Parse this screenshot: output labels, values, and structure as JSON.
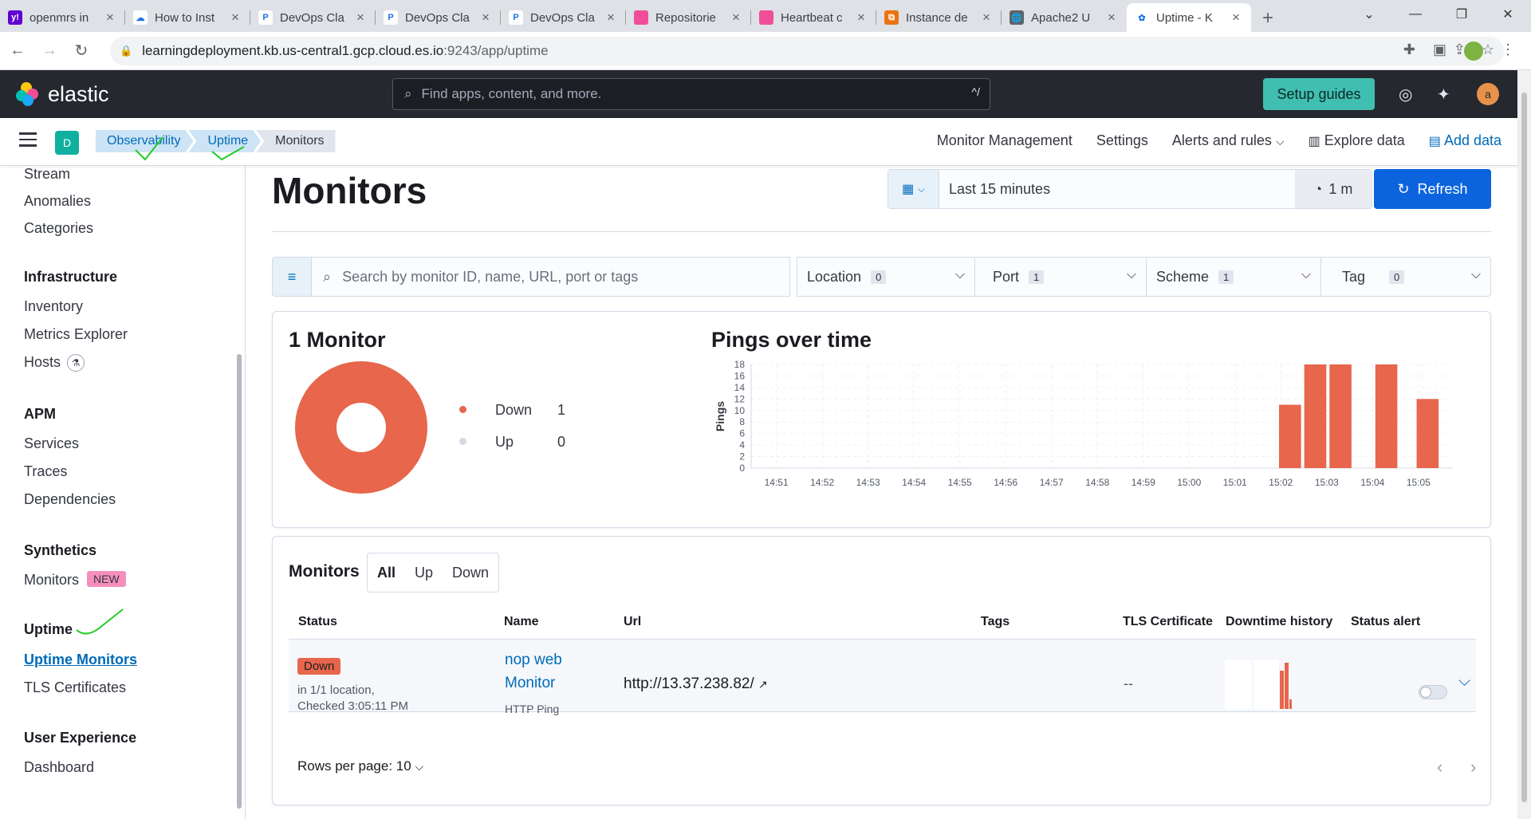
{
  "browser": {
    "tabs": [
      {
        "title": "openmrs in",
        "fav_color": "#6001d2",
        "fav_glyph": "y!"
      },
      {
        "title": "How to Inst",
        "fav_color": "#ffffff",
        "fav_glyph": "☁"
      },
      {
        "title": "DevOps Cla",
        "fav_color": "#ffffff",
        "fav_glyph": "P"
      },
      {
        "title": "DevOps Cla",
        "fav_color": "#ffffff",
        "fav_glyph": "P"
      },
      {
        "title": "DevOps Cla",
        "fav_color": "#ffffff",
        "fav_glyph": "P"
      },
      {
        "title": "Repositorie",
        "fav_color": "#f04e98",
        "fav_glyph": ""
      },
      {
        "title": "Heartbeat c",
        "fav_color": "#f04e98",
        "fav_glyph": ""
      },
      {
        "title": "Instance de",
        "fav_color": "#ec7211",
        "fav_glyph": "⧉"
      },
      {
        "title": "Apache2 U",
        "fav_color": "#5f6368",
        "fav_glyph": "🌐"
      },
      {
        "title": "Uptime - K",
        "fav_color": "#ffffff",
        "fav_glyph": "✿"
      }
    ],
    "url_host": "learningdeployment.kb.us-central1.gcp.cloud.es.io",
    "url_rest": ":9243/app/uptime"
  },
  "header": {
    "brand": "elastic",
    "search_placeholder": "Find apps, content, and more.",
    "search_shortcut": "^/",
    "setup_label": "Setup guides",
    "avatar_letter": "a"
  },
  "subheader": {
    "space_letter": "D",
    "breadcrumbs": [
      "Observability",
      "Uptime",
      "Monitors"
    ],
    "nav": {
      "monitor_management": "Monitor Management",
      "settings": "Settings",
      "alerts": "Alerts and rules",
      "explore": "Explore data",
      "add_data": "Add data"
    }
  },
  "sidebar": {
    "logs_items": [
      "Stream",
      "Anomalies",
      "Categories"
    ],
    "infra_title": "Infrastructure",
    "infra_items": [
      "Inventory",
      "Metrics Explorer",
      "Hosts"
    ],
    "apm_title": "APM",
    "apm_items": [
      "Services",
      "Traces",
      "Dependencies"
    ],
    "synthetics_title": "Synthetics",
    "synthetics_monitors": "Monitors",
    "new_badge": "NEW",
    "uptime_title": "Uptime",
    "uptime_monitors": "Uptime Monitors",
    "tls": "TLS Certificates",
    "ux_title": "User Experience",
    "dashboard": "Dashboard"
  },
  "page": {
    "title": "Monitors",
    "date_range": "Last 15 minutes",
    "refresh_interval": "1 m",
    "refresh_label": "Refresh",
    "search_placeholder": "Search by monitor ID, name, URL, port or tags",
    "filters": [
      {
        "label": "Location",
        "count": "0"
      },
      {
        "label": "Port",
        "count": "1"
      },
      {
        "label": "Scheme",
        "count": "1"
      },
      {
        "label": "Tag",
        "count": "0"
      }
    ]
  },
  "summary": {
    "title": "1 Monitor",
    "down_label": "Down",
    "down_count": "1",
    "up_label": "Up",
    "up_count": "0",
    "down_color": "#e7664c",
    "up_color": "#d3dae6"
  },
  "chart_data": {
    "type": "bar",
    "title": "Pings over time",
    "ylabel": "Pings",
    "xlabel": "",
    "ylim": [
      0,
      18
    ],
    "yticks": [
      0,
      2,
      4,
      6,
      8,
      10,
      12,
      14,
      16,
      18
    ],
    "x_ticks": [
      "14:51",
      "14:52",
      "14:53",
      "14:54",
      "14:55",
      "14:56",
      "14:57",
      "14:58",
      "14:59",
      "15:00",
      "15:01",
      "15:02",
      "15:03",
      "15:04",
      "15:05"
    ],
    "bars": [
      {
        "x": "15:02",
        "value": 11
      },
      {
        "x": "15:03",
        "value": 18
      },
      {
        "x": "15:03",
        "value": 18
      },
      {
        "x": "15:04",
        "value": 18
      },
      {
        "x": "15:05",
        "value": 12
      }
    ],
    "color": "#e7664c",
    "grid": true
  },
  "monitors": {
    "title": "Monitors",
    "filters": [
      "All",
      "Up",
      "Down"
    ],
    "columns": [
      "Status",
      "Name",
      "Url",
      "Tags",
      "TLS Certificate",
      "Downtime history",
      "Status alert"
    ],
    "row": {
      "status": "Down",
      "location": "in 1/1 location,",
      "checked": "Checked 3:05:11 PM",
      "name_line1": "nop web",
      "name_line2": "Monitor",
      "type": "HTTP Ping",
      "url": "http://13.37.238.82/",
      "tls": "--"
    },
    "rows_per_page": "Rows per page: 10"
  }
}
